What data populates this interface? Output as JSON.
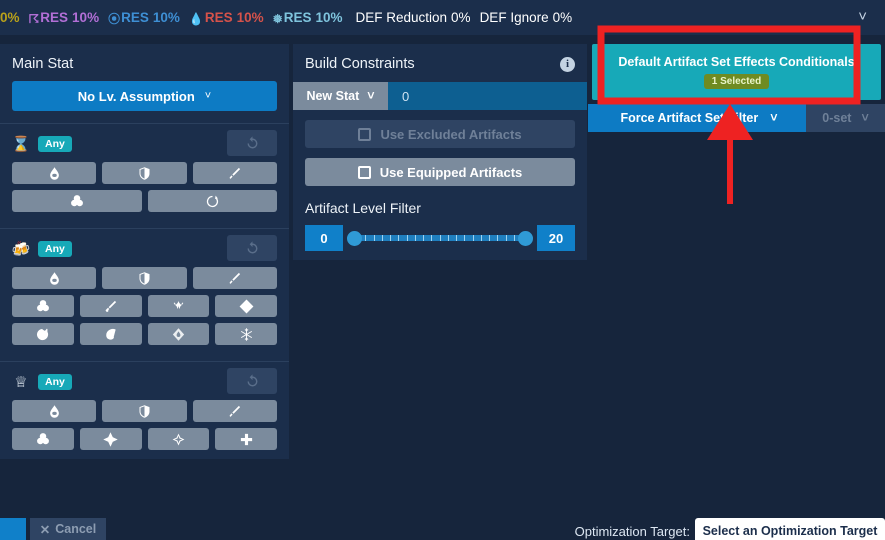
{
  "topbar": {
    "stats": [
      {
        "icon": "dendro-icon",
        "name": "",
        "value": "0%",
        "color": "#b8a11a",
        "truncated": true
      },
      {
        "icon": "electro-icon",
        "name": "RES",
        "value": "10%",
        "color": "#b26fd6"
      },
      {
        "icon": "hydro-icon",
        "name": "RES",
        "value": "10%",
        "color": "#3e8fd4"
      },
      {
        "icon": "pyro-icon",
        "name": "RES",
        "value": "10%",
        "color": "#d6524a"
      },
      {
        "icon": "cryo-icon",
        "name": "RES",
        "value": "10%",
        "color": "#7fc4dd"
      },
      {
        "icon": "",
        "name": "DEF Reduction",
        "value": "0%",
        "color": "#ffffff"
      },
      {
        "icon": "",
        "name": "DEF Ignore",
        "value": "0%",
        "color": "#ffffff"
      }
    ],
    "collapse_icon": "chevron-down-icon"
  },
  "mainstat": {
    "title": "Main Stat",
    "level_assumption_label": "No Lv. Assumption",
    "level_assumption_icon": "chevron-down-icon",
    "slots": [
      {
        "slot_icon": "sands-icon",
        "filter_label": "Any",
        "reset_icon": "reset-icon",
        "rows": [
          [
            {
              "icon": "hp-percent-icon"
            },
            {
              "icon": "def-percent-icon"
            },
            {
              "icon": "atk-percent-icon"
            }
          ],
          [
            {
              "icon": "elemental-mastery-icon"
            },
            {
              "icon": "energy-recharge-icon"
            }
          ]
        ]
      },
      {
        "slot_icon": "goblet-icon",
        "filter_label": "Any",
        "reset_icon": "reset-icon",
        "rows": [
          [
            {
              "icon": "hp-percent-icon"
            },
            {
              "icon": "def-percent-icon"
            },
            {
              "icon": "atk-percent-icon"
            }
          ],
          [
            {
              "icon": "elemental-mastery-icon"
            },
            {
              "icon": "physical-dmg-icon"
            },
            {
              "icon": "anemo-dmg-icon"
            },
            {
              "icon": "geo-dmg-icon"
            }
          ],
          [
            {
              "icon": "electro-dmg-icon"
            },
            {
              "icon": "hydro-dmg-icon"
            },
            {
              "icon": "pyro-dmg-icon"
            },
            {
              "icon": "cryo-dmg-icon"
            }
          ]
        ]
      },
      {
        "slot_icon": "circlet-icon",
        "filter_label": "Any",
        "reset_icon": "reset-icon",
        "rows": [
          [
            {
              "icon": "hp-percent-icon"
            },
            {
              "icon": "def-percent-icon"
            },
            {
              "icon": "atk-percent-icon"
            }
          ],
          [
            {
              "icon": "elemental-mastery-icon"
            },
            {
              "icon": "crit-rate-icon"
            },
            {
              "icon": "crit-dmg-icon"
            },
            {
              "icon": "healing-bonus-icon"
            }
          ]
        ]
      }
    ]
  },
  "build_constraints": {
    "title": "Build Constraints",
    "info_icon": "info-icon",
    "new_stat_label": "New Stat",
    "new_stat_dropdown_icon": "chevron-down-icon",
    "new_stat_value": "0",
    "use_excluded_label": "Use Excluded Artifacts",
    "use_excluded_checked": false,
    "use_excluded_disabled": true,
    "use_equipped_label": "Use Equipped Artifacts",
    "use_equipped_checked": false,
    "artifact_level_filter": {
      "title": "Artifact Level Filter",
      "min": "0",
      "max": "20",
      "range_start": 0,
      "range_end": 20,
      "tick_count": 21
    }
  },
  "artifact_sets": {
    "default_conditionals_label": "Default Artifact Set Effects Conditionals",
    "selected_badge": "1 Selected",
    "force_filter_label": "Force Artifact Set Filter",
    "force_filter_icon": "chevron-down-icon",
    "set_count_label": "0-set",
    "set_count_icon": "chevron-down-icon",
    "set_count_disabled": true
  },
  "bottombar": {
    "cancel_label": "Cancel",
    "cancel_icon": "close-icon",
    "optimization_target_label": "Optimization Target:",
    "optimization_target_value": "Select an Optimization Target"
  },
  "annotation": {
    "highlight_color": "#ee2222",
    "shape": "rectangle-with-arrow",
    "target": "default-artifact-set-effects-conditionals-button"
  }
}
